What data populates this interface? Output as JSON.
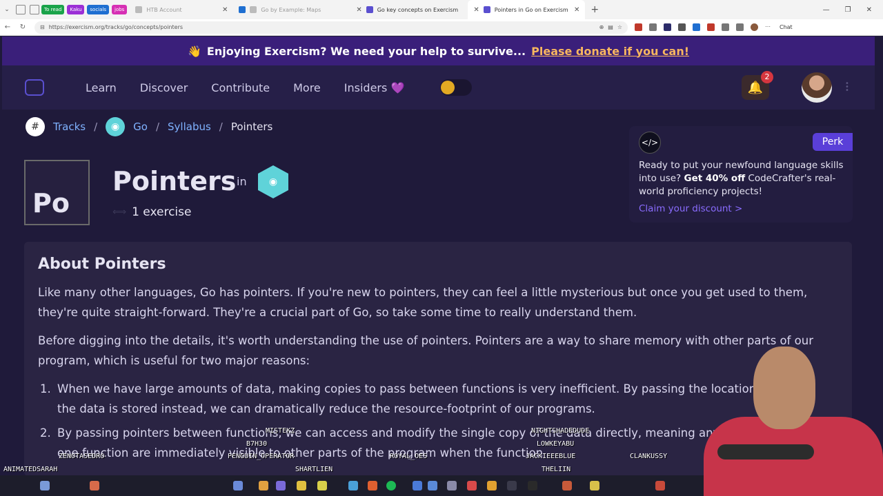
{
  "browser": {
    "tab_groups": [
      {
        "label": "To read",
        "color": "#1aa34a"
      },
      {
        "label": "Kaku",
        "color": "#9b2fd6"
      },
      {
        "label": "socials",
        "color": "#1f6fd1"
      },
      {
        "label": "jobs",
        "color": "#d62fb4"
      }
    ],
    "tabs": [
      {
        "label": "HTB Account",
        "faded": true
      },
      {
        "label": "Go by Example: Maps",
        "faded": true
      },
      {
        "label": "Go key concepts on Exercism",
        "faded": false
      },
      {
        "label": "Pointers in Go on Exercism",
        "faded": false,
        "active": true
      }
    ],
    "url": "https://exercism.org/tracks/go/concepts/pointers",
    "chat_label": "Chat"
  },
  "banner": {
    "emoji": "👋",
    "text": "Enjoying Exercism? We need your help to survive...",
    "link": "Please donate if you can!"
  },
  "nav": {
    "links": [
      "Learn",
      "Discover",
      "Contribute",
      "More",
      "Insiders"
    ],
    "insiders_heart": "💜",
    "notifications_count": "2"
  },
  "breadcrumb": {
    "tracks": "Tracks",
    "track": "Go",
    "syllabus": "Syllabus",
    "current": "Pointers",
    "separator": "/"
  },
  "concept": {
    "icon_text": "Po",
    "title": "Pointers",
    "in_label": "in",
    "exercise_count": "1 exercise"
  },
  "perk": {
    "badge": "Perk",
    "text_before": "Ready to put your newfound language skills into use? ",
    "text_bold": "Get 40% off",
    "text_after": " CodeCrafter's real-world proficiency projects!",
    "cta": "Claim your discount >"
  },
  "about": {
    "title": "About Pointers",
    "paragraph1": "Like many other languages, Go has pointers. If you're new to pointers, they can feel a little mysterious but once you get used to them, they're quite straight-forward. They're a crucial part of Go, so take some time to really understand them.",
    "paragraph2": "Before digging into the details, it's worth understanding the use of pointers. Pointers are a way to share memory with other parts of our program, which is useful for two major reasons:",
    "list": [
      "When we have large amounts of data, making copies to pass between functions is very inefficient. By passing the location of where the data is stored instead, we can dramatically reduce the resource-footprint of our programs.",
      "By passing pointers between functions, we can access and modify the single copy of the data directly, meaning any changes made by one function are immediately visible to other parts of the program when the function"
    ]
  },
  "stream_overlay": {
    "names": [
      "MISTEKZ",
      "NIGHTSHADEDUDE",
      "B7H30",
      "LOWKEYABU",
      "ZENOTASEDRO",
      "PENGUIN_OPERATOR",
      "ROYAL_OES",
      "JACKIEEEBLUE",
      "CLANKUSSY",
      "ANIMATEDSARAH",
      "SHARTLIEN",
      "THELIIN"
    ]
  }
}
